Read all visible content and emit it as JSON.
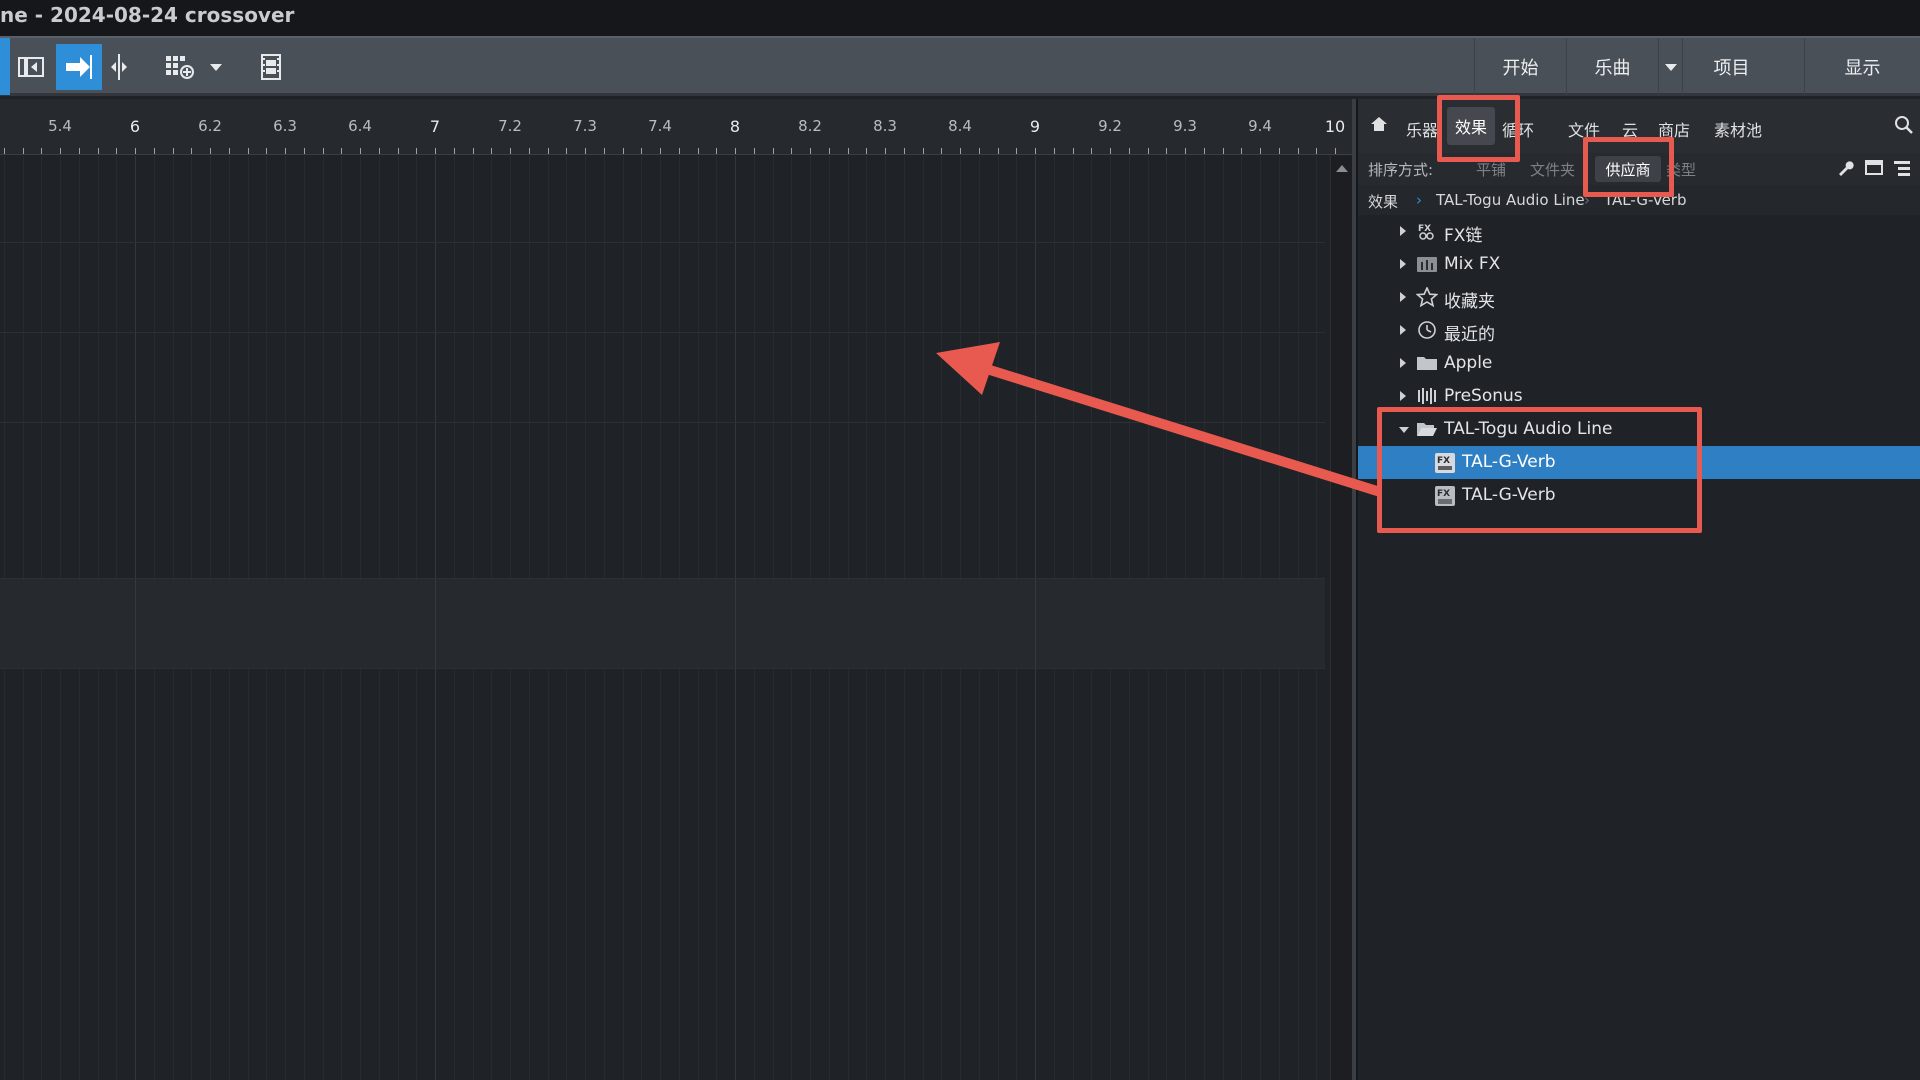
{
  "window": {
    "title": "ne - 2024-08-24 crossover"
  },
  "toolbar": {
    "right_tabs": [
      {
        "label": "开始"
      },
      {
        "label": "乐曲"
      },
      {
        "label": "项目"
      },
      {
        "label": "显示"
      }
    ]
  },
  "ruler": {
    "labels": [
      "5.4",
      "6",
      "6.2",
      "6.3",
      "6.4",
      "7",
      "7.2",
      "7.3",
      "7.4",
      "8",
      "8.2",
      "8.3",
      "8.4",
      "9",
      "9.2",
      "9.3",
      "9.4",
      "10"
    ]
  },
  "browser": {
    "tabs": {
      "instruments": "乐器",
      "effects": "效果",
      "loops": "循环",
      "files": "文件",
      "cloud": "云",
      "shop": "商店",
      "pool": "素材池"
    },
    "sort": {
      "label": "排序方式:",
      "flat": "平铺",
      "folder": "文件夹",
      "vendor": "供应商",
      "type": "类型"
    },
    "breadcrumb": {
      "root": "效果",
      "level1": "TAL-Togu Audio Line",
      "level2": "TAL-G-Verb"
    },
    "tree": [
      {
        "label": "FX链",
        "icon": "fx-chain-icon"
      },
      {
        "label": "Mix FX",
        "icon": "mixfx-icon"
      },
      {
        "label": "收藏夹",
        "icon": "star-icon"
      },
      {
        "label": "最近的",
        "icon": "clock-icon"
      },
      {
        "label": "Apple",
        "icon": "folder-icon"
      },
      {
        "label": "PreSonus",
        "icon": "presonus-icon"
      },
      {
        "label": "TAL-Togu Audio Line",
        "icon": "folder-open-icon"
      },
      {
        "label": "TAL-G-Verb",
        "icon": "fx-plugin-icon",
        "selected": true
      },
      {
        "label": "TAL-G-Verb",
        "icon": "fx-plugin-au-icon"
      }
    ]
  },
  "colors": {
    "accent": "#2e8fd8",
    "selection": "#2e7fc3",
    "annotation": "#e85a4f"
  }
}
